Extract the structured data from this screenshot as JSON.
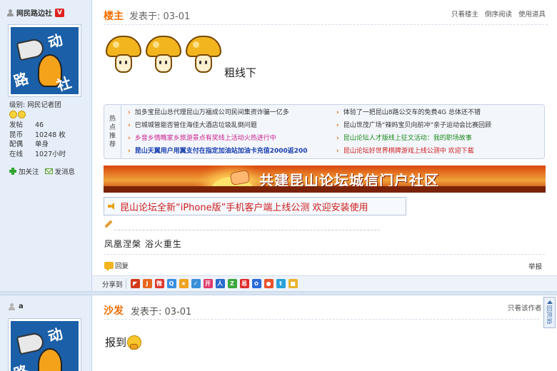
{
  "user1": {
    "name": "网民路边社",
    "badge": "V",
    "level": "级别: 网民记者团",
    "stats": [
      {
        "key": "发帖",
        "value": "46"
      },
      {
        "key": "昆币",
        "value": "10248 枚"
      },
      {
        "key": "配偶",
        "value": "单身"
      },
      {
        "key": "在线",
        "value": "1027小时"
      }
    ],
    "follow_label": "加关注",
    "message_label": "发消息"
  },
  "post1": {
    "floor": "楼主",
    "time": "发表于: 03-01",
    "links": [
      "只看楼主",
      "倒序阅读",
      "使用道具"
    ],
    "body_text": "粗线下",
    "banner_text": "共建昆山论坛城信门户社区",
    "notice_text": "昆山论坛全新“iPhone版”手机客户端上线公测 欢迎安装使用",
    "signature": "凤凰涅槃 浴火重生",
    "reply_label": "回复",
    "report_label": "举报",
    "share_label": "分享到"
  },
  "hot": {
    "label": "热点推荐",
    "items_left": [
      {
        "text": "加多宝昆山总代理昆山万福成公司民间集资诈骗一亿多",
        "color": "#333333"
      },
      {
        "text": "巴城城管能否管住海佳大酒店垃圾乱倒问题",
        "color": "#333333"
      },
      {
        "text": "乡音乡情瞧家乡旅游景点有奖线上活动火热进行中",
        "color": "#cc1e8e"
      },
      {
        "text": "昆山天翼用户用翼支付在指定加油站加油卡充值2000返200",
        "color": "#1a3fb0"
      }
    ],
    "items_right": [
      {
        "text": "体验了一把昆山8路公交车的免费4G 总体还不错",
        "color": "#333333"
      },
      {
        "text": "昆山世茂广场“辣妈宝贝向前冲”亲子运动会比赛回顾",
        "color": "#333333"
      },
      {
        "text": "昆山论坛人才版线上征文活动：我的职场故事",
        "color": "#1a8a1a"
      },
      {
        "text": "昆山论坛好世界棋牌游戏上线公测中 欢迎下载",
        "color": "#cc1e1e"
      }
    ]
  },
  "share_icons": [
    {
      "name": "share-icon-1",
      "color": "#d23a1a",
      "glyph": "◤"
    },
    {
      "name": "share-icon-2",
      "color": "#e8661e",
      "glyph": "J"
    },
    {
      "name": "share-icon-3",
      "color": "#e0342c",
      "glyph": "微"
    },
    {
      "name": "share-icon-4",
      "color": "#3a8ee0",
      "glyph": "Q"
    },
    {
      "name": "share-icon-5",
      "color": "#f0a21e",
      "glyph": "★"
    },
    {
      "name": "share-icon-6",
      "color": "#3b8fd8",
      "glyph": "✓"
    },
    {
      "name": "share-icon-7",
      "color": "#e03a6a",
      "glyph": "开"
    },
    {
      "name": "share-icon-8",
      "color": "#2a6acc",
      "glyph": "人"
    },
    {
      "name": "share-icon-9",
      "color": "#3aa83a",
      "glyph": "Z"
    },
    {
      "name": "share-icon-10",
      "color": "#e02a2a",
      "glyph": "易"
    },
    {
      "name": "share-icon-11",
      "color": "#2a6ad8",
      "glyph": "✿"
    },
    {
      "name": "share-icon-12",
      "color": "#e8502a",
      "glyph": "●"
    },
    {
      "name": "share-icon-13",
      "color": "#2aa0d8",
      "glyph": "t"
    },
    {
      "name": "share-icon-14",
      "color": "#e8b22a",
      "glyph": "■"
    }
  ],
  "user2": {
    "name": "a"
  },
  "post2": {
    "floor": "沙发",
    "time": "发表于: 03-01",
    "only_author": "只看该作者",
    "body_text": "报到",
    "backtop": "回顶部"
  }
}
